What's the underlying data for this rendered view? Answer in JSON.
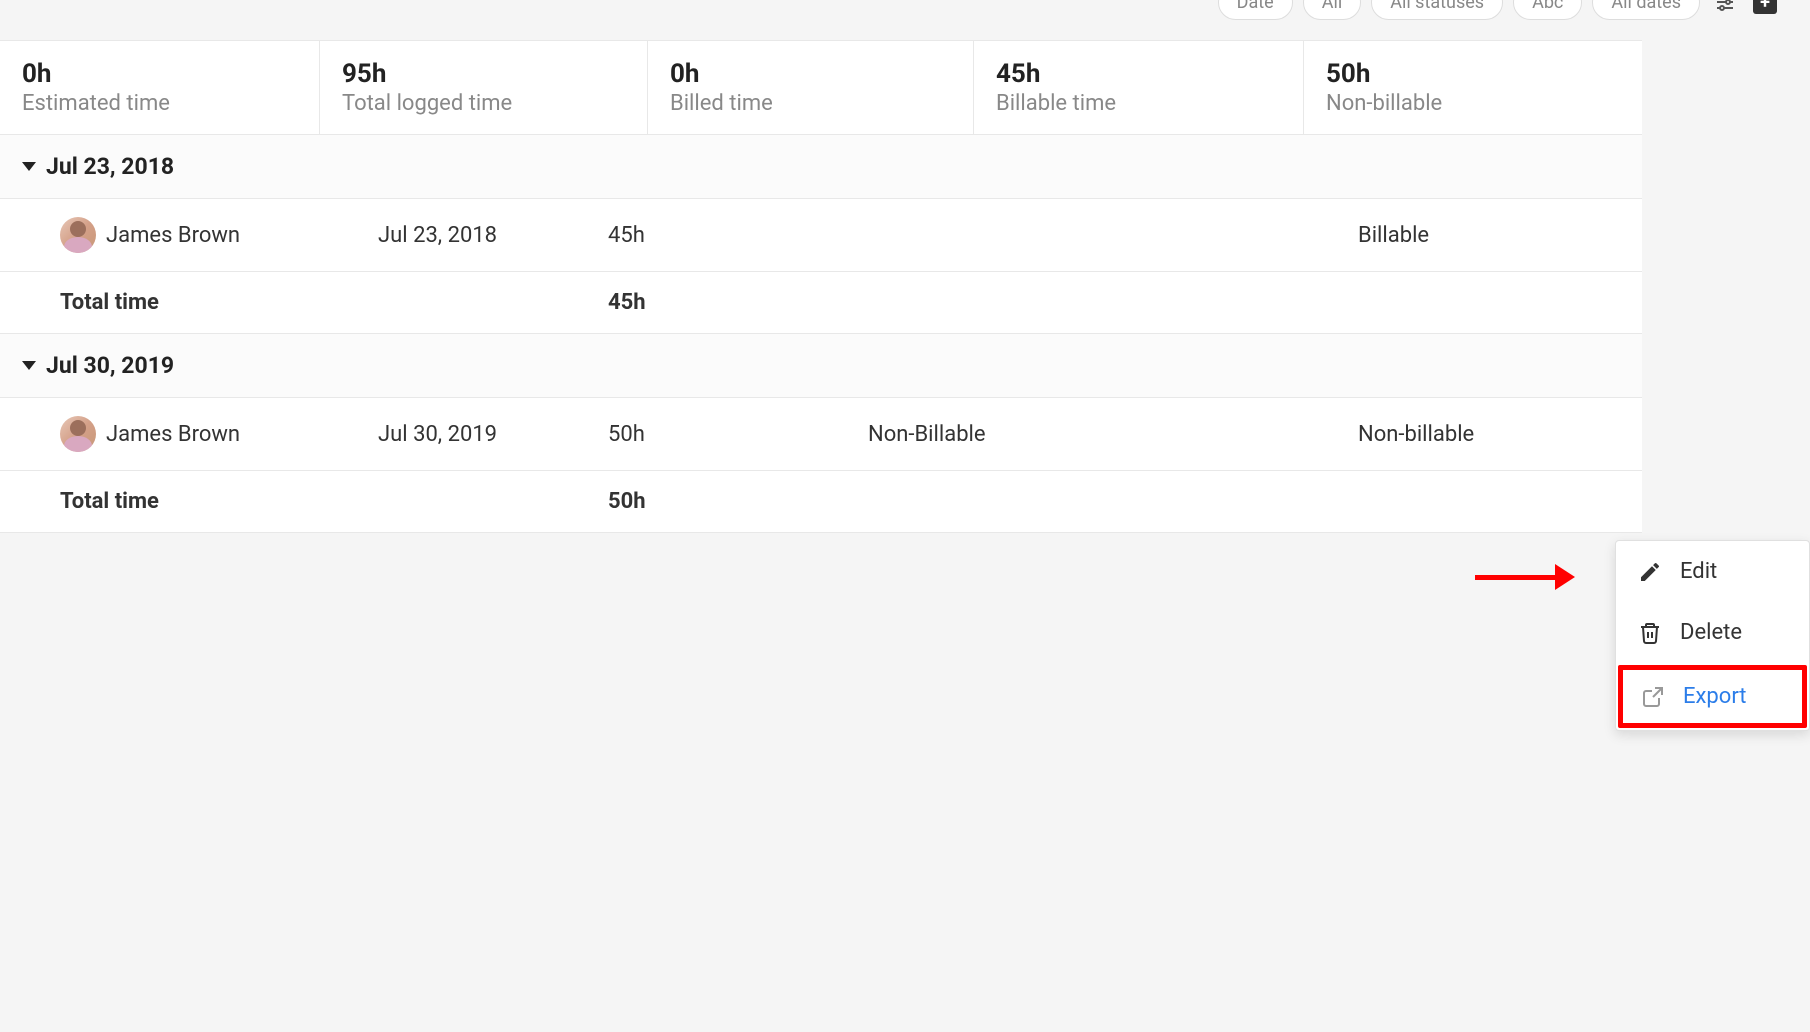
{
  "toolbar": {
    "filters": [
      {
        "label": "Date"
      },
      {
        "label": "All"
      },
      {
        "label": "All statuses"
      },
      {
        "label": "Abc"
      },
      {
        "label": "All dates"
      }
    ]
  },
  "summary": [
    {
      "value": "0h",
      "label": "Estimated time"
    },
    {
      "value": "95h",
      "label": "Total logged time"
    },
    {
      "value": "0h",
      "label": "Billed time"
    },
    {
      "value": "45h",
      "label": "Billable time"
    },
    {
      "value": "50h",
      "label": "Non-billable"
    }
  ],
  "groups": [
    {
      "date": "Jul 23, 2018",
      "entries": [
        {
          "user": "James Brown",
          "date": "Jul 23, 2018",
          "time": "45h",
          "desc": "",
          "status": "Billable"
        }
      ],
      "total_label": "Total time",
      "total_time": "45h"
    },
    {
      "date": "Jul 30, 2019",
      "entries": [
        {
          "user": "James Brown",
          "date": "Jul 30, 2019",
          "time": "50h",
          "desc": "Non-Billable",
          "status": "Non-billable"
        }
      ],
      "total_label": "Total time",
      "total_time": "50h"
    }
  ],
  "context_menu": {
    "edit": "Edit",
    "delete": "Delete",
    "export": "Export"
  }
}
